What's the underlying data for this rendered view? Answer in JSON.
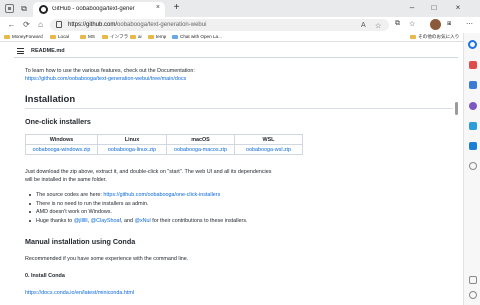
{
  "browser": {
    "tab": {
      "title": "GitHub - oobabooga/text-gener",
      "close": "×"
    },
    "new_tab": "+",
    "window_controls": {
      "minimize": "–",
      "maximize": "□",
      "close": "×"
    },
    "nav": {
      "back": "←",
      "refresh": "⟳",
      "home": "⌂"
    },
    "address": {
      "host": "https://github.com/",
      "path": "oobabooga/text-generation-webui"
    },
    "address_icons": {
      "zoom": "A",
      "star": "☆"
    },
    "extensions": {
      "split": "⧉",
      "favorites": "☆",
      "collections": "⧆",
      "more": "⋯"
    }
  },
  "bookmarks": [
    {
      "label": "MoneyForward"
    },
    {
      "label": "Local"
    },
    {
      "label": "MS"
    },
    {
      "label": "インフラ"
    },
    {
      "label": "ai"
    },
    {
      "label": "temp"
    },
    {
      "label": "Chat with Open La..."
    }
  ],
  "bookmarks_other": "その他のお気に入り",
  "readme": {
    "file_title": "README.md",
    "intro_text": "To learn how to use the various features, check out the Documentation:",
    "doc_link": "https://github.com/oobabooga/text-generation-webui/tree/main/docs",
    "installation_heading": "Installation",
    "oneclick_heading": "One-click installers",
    "table": {
      "headers": [
        "Windows",
        "Linux",
        "macOS",
        "WSL"
      ],
      "cells": [
        "oobabooga-windows.zip",
        "oobabooga-linux.zip",
        "oobabooga-macos.zip",
        "oobabooga-wsl.zip"
      ]
    },
    "extract_text_1": "Just download the zip above, extract it, and double-click on \"start\". The web UI and all its dependencies",
    "extract_text_2": "will be installed in the same folder.",
    "bullets": {
      "source_prefix": "The source codes are here: ",
      "source_link": "https://github.com/oobabooga/one-click-installers",
      "admin": "There is no need to run the installers as admin.",
      "amd": "AMD doesn't work on Windows.",
      "thanks_prefix": "Huge thanks to ",
      "user1": "@jllllll",
      "sep1": ", ",
      "user2": "@ClayShoaf",
      "sep2": ", and ",
      "user3": "@xNul",
      "thanks_suffix": " for their contributions to these installers."
    },
    "manual_heading": "Manual installation using Conda",
    "manual_text": "Recommended if you have some experience with the command line.",
    "install_conda_heading": "0. Install Conda",
    "conda_link": "https://docs.conda.io/en/latest/miniconda.html"
  },
  "colors": {
    "link": "#0969da",
    "text": "#24292f",
    "bookmark_folder": "#e6b94a",
    "edge_blue": "#1a73e8"
  }
}
